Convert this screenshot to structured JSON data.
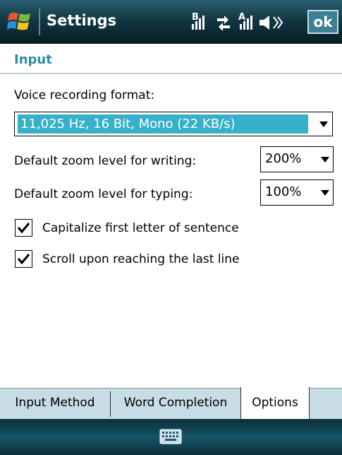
{
  "titlebar": {
    "app_title": "Settings",
    "ok_label": "ok"
  },
  "page": {
    "heading": "Input"
  },
  "options": {
    "voice_format_label": "Voice recording format:",
    "voice_format_value": "11,025 Hz, 16 Bit, Mono (22 KB/s)",
    "writing_zoom_label": "Default zoom level for writing:",
    "writing_zoom_value": "200%",
    "typing_zoom_label": "Default zoom level for typing:",
    "typing_zoom_value": "100%",
    "capitalize_label": "Capitalize first letter of sentence",
    "capitalize_checked": true,
    "scroll_label": "Scroll upon reaching the last line",
    "scroll_checked": true
  },
  "tabs": [
    {
      "label": "Input Method",
      "active": false
    },
    {
      "label": "Word Completion",
      "active": false
    },
    {
      "label": "Options",
      "active": true
    }
  ],
  "status": {
    "icons": [
      "bluetooth-signal-icon",
      "data-connection-icon",
      "signal-strength-icon",
      "volume-muted-icon"
    ]
  },
  "colors": {
    "accent": "#2c8ea8",
    "selection": "#37b0c9",
    "tab_bg": "#c7dce4"
  }
}
